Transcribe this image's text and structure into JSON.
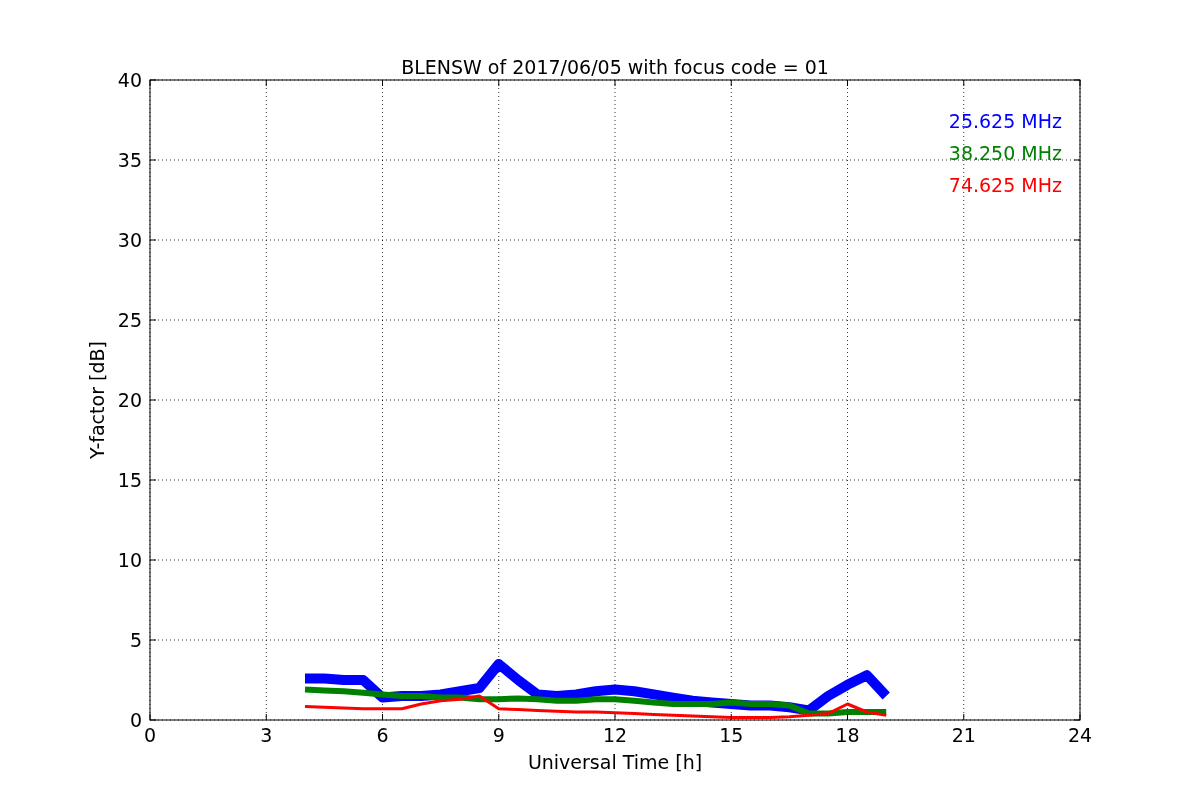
{
  "figure": {
    "chart_data": {
      "type": "line",
      "title": "BLENSW of 2017/06/05 with focus code = 01",
      "xlabel": "Universal Time [h]",
      "ylabel": "Y-factor [dB]",
      "x": [
        4,
        4.5,
        5,
        5.5,
        6,
        6.5,
        7,
        7.5,
        8,
        8.5,
        9,
        9.5,
        10,
        10.5,
        11,
        11.5,
        12,
        12.5,
        13,
        13.5,
        14,
        14.5,
        15,
        15.5,
        16,
        16.5,
        17,
        17.5,
        18,
        18.5,
        19
      ],
      "series": [
        {
          "name": "25.625 MHz",
          "color": "#0000ff",
          "values": [
            2.6,
            2.6,
            2.5,
            2.5,
            1.4,
            1.5,
            1.5,
            1.6,
            1.8,
            2.0,
            3.5,
            2.5,
            1.6,
            1.5,
            1.6,
            1.8,
            1.9,
            1.8,
            1.6,
            1.4,
            1.2,
            1.1,
            1.0,
            0.9,
            0.9,
            0.8,
            0.6,
            1.5,
            2.2,
            2.8,
            1.5
          ]
        },
        {
          "name": "38.250 MHz",
          "color": "#008000",
          "values": [
            1.9,
            1.85,
            1.8,
            1.7,
            1.6,
            1.5,
            1.5,
            1.4,
            1.4,
            1.3,
            1.3,
            1.35,
            1.3,
            1.2,
            1.2,
            1.3,
            1.3,
            1.2,
            1.1,
            1.0,
            1.0,
            1.0,
            1.1,
            1.0,
            1.0,
            0.9,
            0.4,
            0.4,
            0.5,
            0.5,
            0.5
          ]
        },
        {
          "name": "74.625 MHz",
          "color": "#ff0000",
          "values": [
            0.85,
            0.8,
            0.75,
            0.7,
            0.7,
            0.7,
            1.0,
            1.2,
            1.3,
            1.5,
            0.7,
            0.65,
            0.6,
            0.55,
            0.5,
            0.5,
            0.45,
            0.4,
            0.35,
            0.3,
            0.25,
            0.2,
            0.15,
            0.15,
            0.15,
            0.2,
            0.3,
            0.4,
            1.0,
            0.5,
            0.3
          ]
        }
      ],
      "grid": true,
      "xlim": [
        0,
        24
      ],
      "ylim": [
        0,
        40
      ],
      "xticks": [
        0,
        3,
        6,
        9,
        12,
        15,
        18,
        21,
        24
      ],
      "yticks": [
        0,
        5,
        10,
        15,
        20,
        25,
        30,
        35,
        40
      ]
    }
  }
}
